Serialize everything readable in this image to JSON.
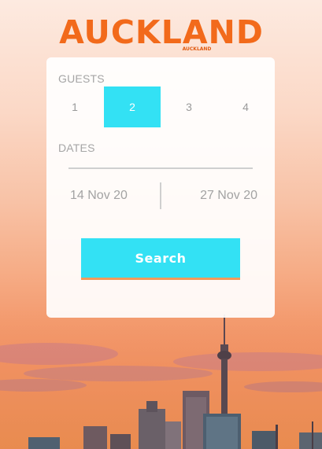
{
  "brand": {
    "logo_text": "AUCKLAND",
    "logo_subtext": "AUCKLAND",
    "color": "#f26a1b"
  },
  "guests": {
    "label": "GUESTS",
    "options": [
      "1",
      "2",
      "3",
      "4"
    ],
    "selected": "2"
  },
  "dates": {
    "label": "DATES",
    "start": "14 Nov 20",
    "end": "27 Nov 20"
  },
  "search": {
    "label": "Search",
    "color": "#33e1f4"
  },
  "background": {
    "description_icon": "auckland-skyline-sunset"
  }
}
